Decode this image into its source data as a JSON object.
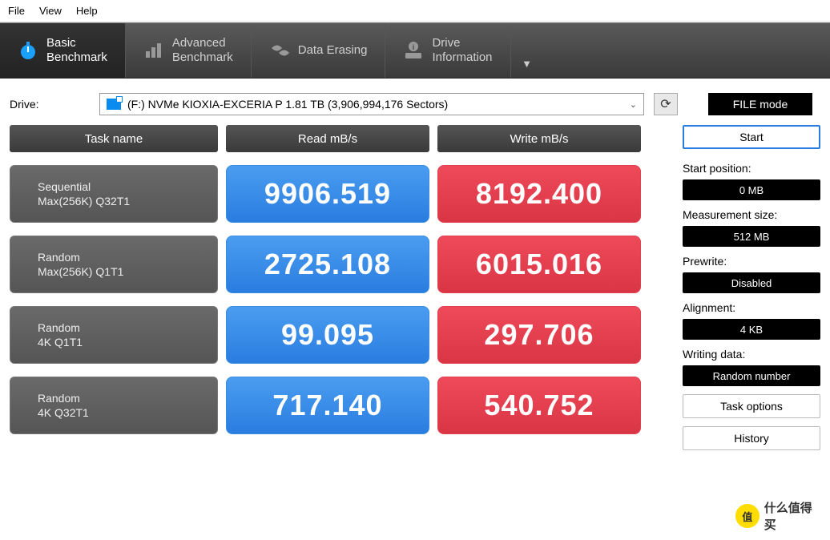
{
  "menu": {
    "file": "File",
    "view": "View",
    "help": "Help"
  },
  "toolbar": {
    "basic": {
      "line1": "Basic",
      "line2": "Benchmark"
    },
    "advanced": {
      "line1": "Advanced",
      "line2": "Benchmark"
    },
    "erase": {
      "line1": "Data Erasing"
    },
    "info": {
      "line1": "Drive",
      "line2": "Information"
    }
  },
  "drive": {
    "label": "Drive:",
    "selected": "(F:) NVMe KIOXIA-EXCERIA P  1.81 TB (3,906,994,176 Sectors)",
    "mode_button": "FILE mode"
  },
  "headers": {
    "task": "Task name",
    "read": "Read mB/s",
    "write": "Write mB/s"
  },
  "rows": [
    {
      "name1": "Sequential",
      "name2": "Max(256K) Q32T1",
      "read": "9906.519",
      "write": "8192.400"
    },
    {
      "name1": "Random",
      "name2": "Max(256K) Q1T1",
      "read": "2725.108",
      "write": "6015.016"
    },
    {
      "name1": "Random",
      "name2": "4K Q1T1",
      "read": "99.095",
      "write": "297.706"
    },
    {
      "name1": "Random",
      "name2": "4K Q32T1",
      "read": "717.140",
      "write": "540.752"
    }
  ],
  "side": {
    "start": "Start",
    "start_pos_label": "Start position:",
    "start_pos_value": "0 MB",
    "meas_label": "Measurement size:",
    "meas_value": "512 MB",
    "prewrite_label": "Prewrite:",
    "prewrite_value": "Disabled",
    "align_label": "Alignment:",
    "align_value": "4 KB",
    "writedata_label": "Writing data:",
    "writedata_value": "Random number",
    "task_options": "Task options",
    "history": "History"
  },
  "watermark": "什么值得买"
}
